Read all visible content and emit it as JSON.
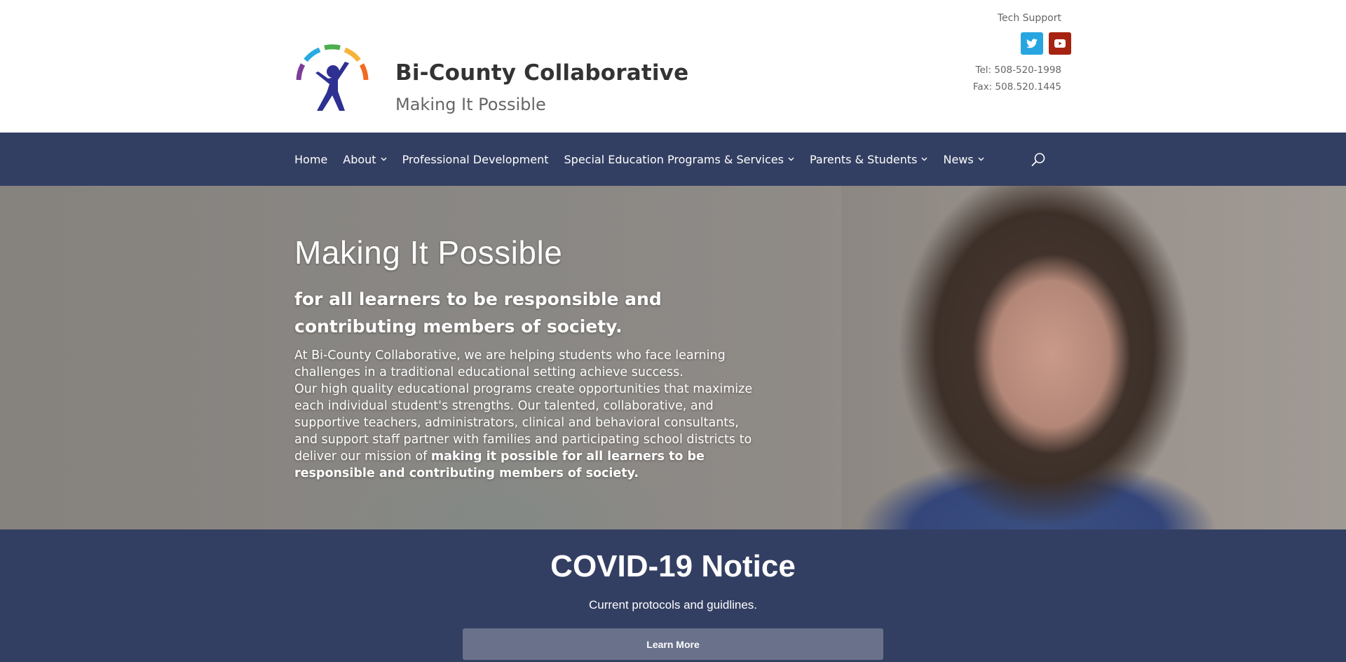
{
  "header": {
    "site_title": "Bi-County Collaborative",
    "tagline": "Making It Possible",
    "tech_support_label": "Tech Support",
    "social": [
      {
        "name": "twitter",
        "icon": "twitter-icon",
        "color": "#27a5e0"
      },
      {
        "name": "youtube",
        "icon": "youtube-icon",
        "color": "#a62311"
      }
    ],
    "tel": "Tel: 508-520-1998",
    "fax": "Fax: 508.520.1445"
  },
  "logo": {
    "arc_colors": [
      "#7d3c98",
      "#29abe2",
      "#4cae4c",
      "#f7b23b",
      "#f06c22"
    ],
    "figure_color": "#2e3192"
  },
  "nav": {
    "background": "#333f62",
    "items": [
      {
        "label": "Home",
        "has_dropdown": false
      },
      {
        "label": "About",
        "has_dropdown": true
      },
      {
        "label": "Professional Development",
        "has_dropdown": false
      },
      {
        "label": "Special Education Programs & Services",
        "has_dropdown": true
      },
      {
        "label": "Parents & Students",
        "has_dropdown": true
      },
      {
        "label": "News",
        "has_dropdown": true
      }
    ],
    "search_icon": "search-icon"
  },
  "hero": {
    "title": "Making It Possible",
    "subtitle": "for all learners to be responsible and contributing members of society.",
    "body_line1": "At Bi-County Collaborative, we are helping students who face learning challenges in a traditional educational setting achieve success.",
    "body_line2": "Our high quality educational programs create opportunities that maximize each individual student's strengths.  Our talented, collaborative, and supportive teachers, administrators, clinical and behavioral consultants, and support staff partner with families and participating school districts to deliver our mission of ",
    "body_bold": "making it possible for all learners to be responsible and contributing members of society."
  },
  "covid": {
    "title": "COVID-19 Notice",
    "subtitle": "Current protocols and guidlines.",
    "button_label": "Learn More",
    "button_color": "#6a718a"
  }
}
